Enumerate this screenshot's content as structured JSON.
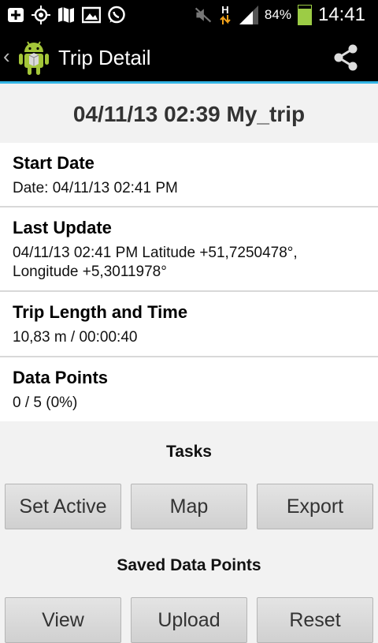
{
  "status_bar": {
    "battery_percent": "84%",
    "time": "14:41",
    "network_type": "H",
    "battery_level": 0.84,
    "icons": [
      "add-icon",
      "gps-icon",
      "map-icon",
      "gallery-icon",
      "whatsapp-icon",
      "mute-icon",
      "data-arrows-icon",
      "signal-icon",
      "battery-icon"
    ]
  },
  "action_bar": {
    "back": "‹",
    "title": "Trip Detail",
    "share_icon": "share-icon"
  },
  "trip": {
    "header": "04/11/13 02:39 My_trip"
  },
  "fields": [
    {
      "label": "Start Date",
      "value": "Date: 04/11/13 02:41 PM"
    },
    {
      "label": "Last Update",
      "value_line1": "04/11/13 02:41 PM Latitude +51,7250478°,",
      "value_line2": "Longitude +5,3011978°"
    },
    {
      "label": "Trip Length and Time",
      "value": "10,83 m / 00:00:40"
    },
    {
      "label": "Data Points",
      "value": "0 / 5 (0%)"
    }
  ],
  "tasks": {
    "title": "Tasks",
    "buttons": [
      "Set Active",
      "Map",
      "Export"
    ]
  },
  "saved_points": {
    "title": "Saved Data Points",
    "buttons": [
      "View",
      "Upload",
      "Reset"
    ]
  },
  "colors": {
    "accent": "#33b5e5",
    "battery": "#9ccc45",
    "android_green": "#a4c639"
  }
}
